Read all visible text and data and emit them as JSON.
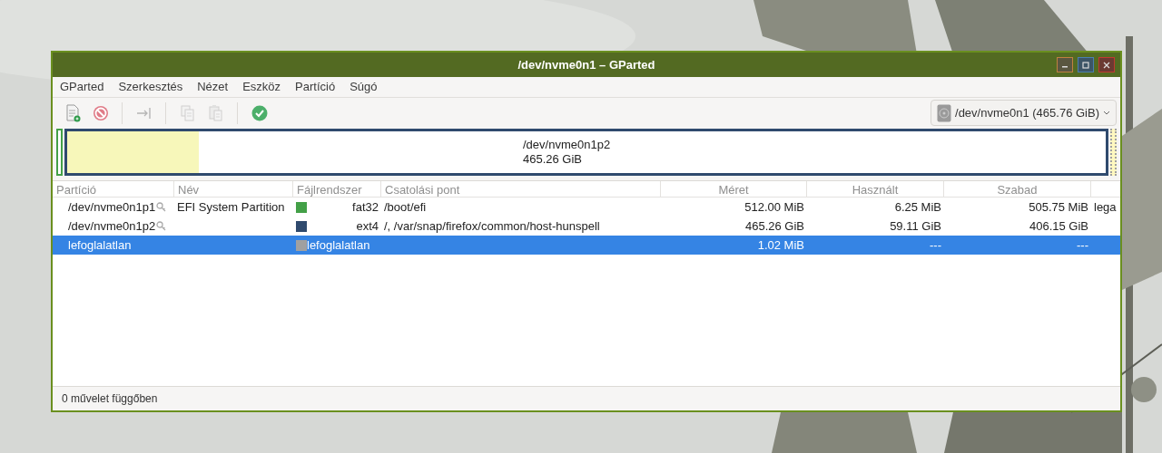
{
  "window": {
    "title": "/dev/nvme0n1 – GParted",
    "active": true
  },
  "menu": [
    "GParted",
    "Szerkesztés",
    "Nézet",
    "Eszköz",
    "Partíció",
    "Súgó"
  ],
  "toolbar": [
    {
      "kind": "new",
      "disabled": false
    },
    {
      "kind": "delete",
      "disabled": false
    },
    {
      "kind": "separator"
    },
    {
      "kind": "resize",
      "disabled": true
    },
    {
      "kind": "separator"
    },
    {
      "kind": "copy",
      "disabled": true
    },
    {
      "kind": "paste",
      "disabled": true
    },
    {
      "kind": "separator"
    },
    {
      "kind": "apply",
      "disabled": false
    }
  ],
  "device_selector": {
    "value": "/dev/nvme0n1 (465.76 GiB)"
  },
  "disk_map": [
    {
      "kind": "small",
      "color": "#43a047"
    },
    {
      "kind": "main",
      "color": "#2f4a6e",
      "level": 0.127,
      "name": "/dev/nvme0n1p2",
      "size": "465.26 GiB"
    },
    {
      "kind": "unallocated",
      "color": "#a0a0a0"
    }
  ],
  "table": {
    "columns": [
      "Partíció",
      "Név",
      "Fájlrendszer",
      "Csatolási pont",
      "Méret",
      "Használt",
      "Szabad"
    ],
    "rows": [
      {
        "partition": "/dev/nvme0n1p1",
        "locked": true,
        "name": "EFI System Partition",
        "color": "#43a047",
        "filesystem": "fat32",
        "mount": "/boot/efi",
        "size": "512.00 MiB",
        "used": "6.25 MiB",
        "free": "505.75 MiB",
        "column_8": "lega",
        "selected": false
      },
      {
        "partition": "/dev/nvme0n1p2",
        "locked": true,
        "color": "#2f4a6e",
        "filesystem": "ext4",
        "mount": "/, /var/snap/firefox/common/host-hunspell",
        "size": "465.26 GiB",
        "used": "59.11 GiB",
        "free": "406.15 GiB",
        "selected": false
      },
      {
        "partition": "lefoglalatlan",
        "locked": false,
        "color": "#a0a0a0",
        "filesystem": "lefoglalatlan",
        "size": "1.02 MiB",
        "used": "---",
        "free": "---",
        "selected": true
      }
    ]
  },
  "status_bar": "0 művelet függőben"
}
